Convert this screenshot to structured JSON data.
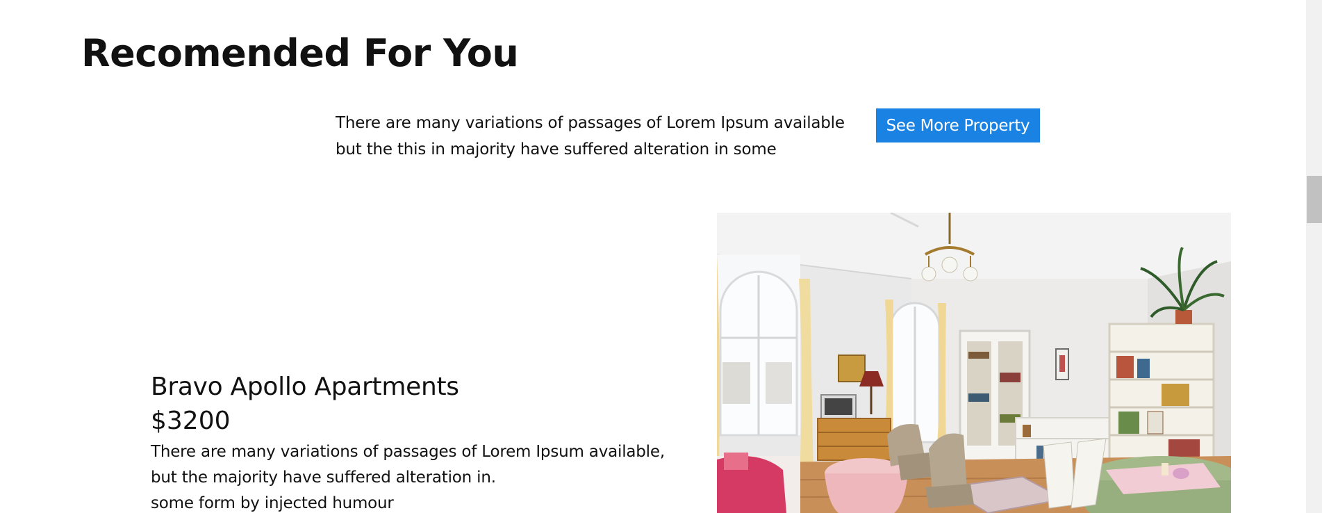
{
  "section": {
    "title": "Recomended For You",
    "intro_line1": "There are many variations of passages of Lorem Ipsum available",
    "intro_line2": "but the this in majority have suffered alteration in some",
    "see_more_label": "See More Property",
    "accent_color": "#1a82e2"
  },
  "property": {
    "name": "Bravo Apollo Apartments",
    "price": "$3200",
    "desc_line1": "There are many variations of passages of Lorem Ipsum available,",
    "desc_line2": "but the majority have suffered alteration in.",
    "desc_line3": "some form by injected humour",
    "image_subject": "bright living room interior with chandelier, bookshelves and dining table"
  }
}
